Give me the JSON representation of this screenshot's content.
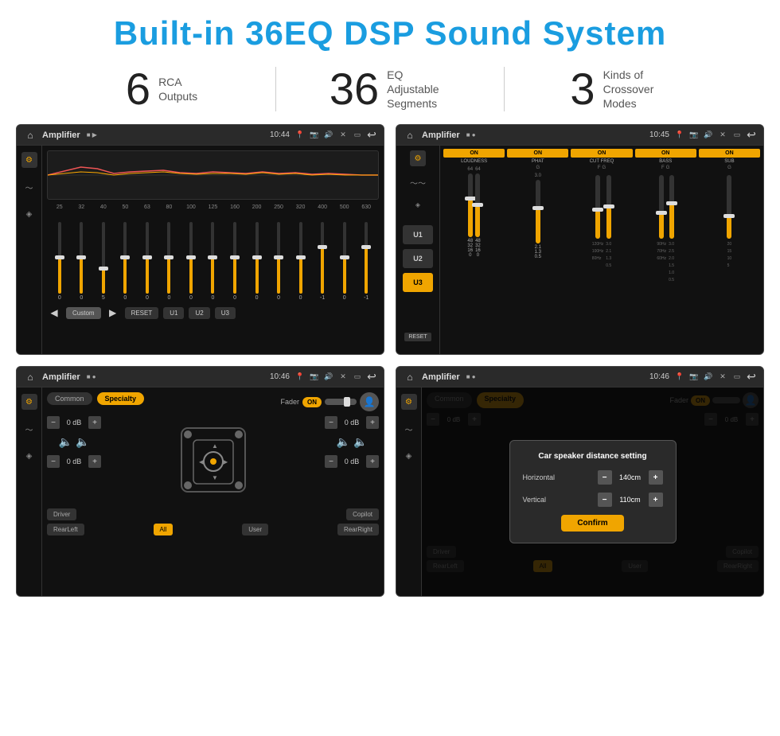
{
  "header": {
    "title": "Built-in 36EQ DSP Sound System",
    "color": "#1a9de0"
  },
  "stats": [
    {
      "number": "6",
      "text": "RCA\nOutputs"
    },
    {
      "number": "36",
      "text": "EQ Adjustable\nSegments"
    },
    {
      "number": "3",
      "text": "Kinds of\nCrossover Modes"
    }
  ],
  "screen1": {
    "topbar": {
      "title": "Amplifier",
      "time": "10:44"
    },
    "eq_labels": [
      "25",
      "32",
      "40",
      "50",
      "63",
      "80",
      "100",
      "125",
      "160",
      "200",
      "250",
      "320",
      "400",
      "500",
      "630"
    ],
    "eq_values": [
      "0",
      "0",
      "5",
      "0",
      "0",
      "0",
      "0",
      "0",
      "0",
      "0",
      "0",
      "0",
      "-1",
      "0",
      "-1"
    ],
    "eq_positions": [
      50,
      50,
      35,
      50,
      50,
      50,
      50,
      50,
      50,
      50,
      50,
      50,
      65,
      50,
      65
    ],
    "bottom_btns": [
      "Custom",
      "RESET",
      "U1",
      "U2",
      "U3"
    ]
  },
  "screen2": {
    "topbar": {
      "title": "Amplifier",
      "time": "10:45"
    },
    "u_btns": [
      "U1",
      "U2",
      "U3"
    ],
    "active_u": "U3",
    "channels": [
      {
        "label": "LOUDNESS",
        "toggle": "ON",
        "fills": [
          60,
          50
        ]
      },
      {
        "label": "PHAT",
        "toggle": "ON",
        "sublabels": [
          "G"
        ],
        "fills": [
          55
        ]
      },
      {
        "label": "CUT FREQ",
        "toggle": "ON",
        "sublabels": [
          "F",
          "G"
        ],
        "fills": [
          45,
          50
        ],
        "freqs": [
          "120Hz",
          "100Hz",
          "80Hz"
        ]
      },
      {
        "label": "BASS",
        "toggle": "ON",
        "sublabels": [
          "F",
          "G"
        ],
        "fills": [
          40,
          55
        ],
        "freqs": [
          "90Hz",
          "70Hz",
          "60Hz"
        ]
      },
      {
        "label": "SUB",
        "toggle": "ON",
        "sublabels": [
          "G"
        ],
        "fills": [
          35
        ]
      }
    ],
    "reset_label": "RESET"
  },
  "screen3": {
    "topbar": {
      "title": "Amplifier",
      "time": "10:46"
    },
    "tabs": [
      "Common",
      "Specialty"
    ],
    "active_tab": "Specialty",
    "fader_label": "Fader",
    "fader_toggle": "ON",
    "vol_controls": [
      {
        "value": "0 dB",
        "position": "top-left"
      },
      {
        "value": "0 dB",
        "position": "top-right"
      },
      {
        "value": "0 dB",
        "position": "bottom-left"
      },
      {
        "value": "0 dB",
        "position": "bottom-right"
      }
    ],
    "bottom_btns": [
      "Driver",
      "Copilot",
      "RearLeft",
      "All",
      "User",
      "RearRight"
    ],
    "active_btn": "All"
  },
  "screen4": {
    "topbar": {
      "title": "Amplifier",
      "time": "10:46"
    },
    "tabs": [
      "Common",
      "Specialty"
    ],
    "dialog": {
      "title": "Car speaker distance setting",
      "rows": [
        {
          "label": "Horizontal",
          "value": "140cm"
        },
        {
          "label": "Vertical",
          "value": "110cm"
        }
      ],
      "confirm_label": "Confirm"
    },
    "fader_toggle": "ON",
    "bottom_btns": [
      "Driver",
      "Copilot",
      "RearLeft",
      "All",
      "User",
      "RearRight"
    ]
  }
}
